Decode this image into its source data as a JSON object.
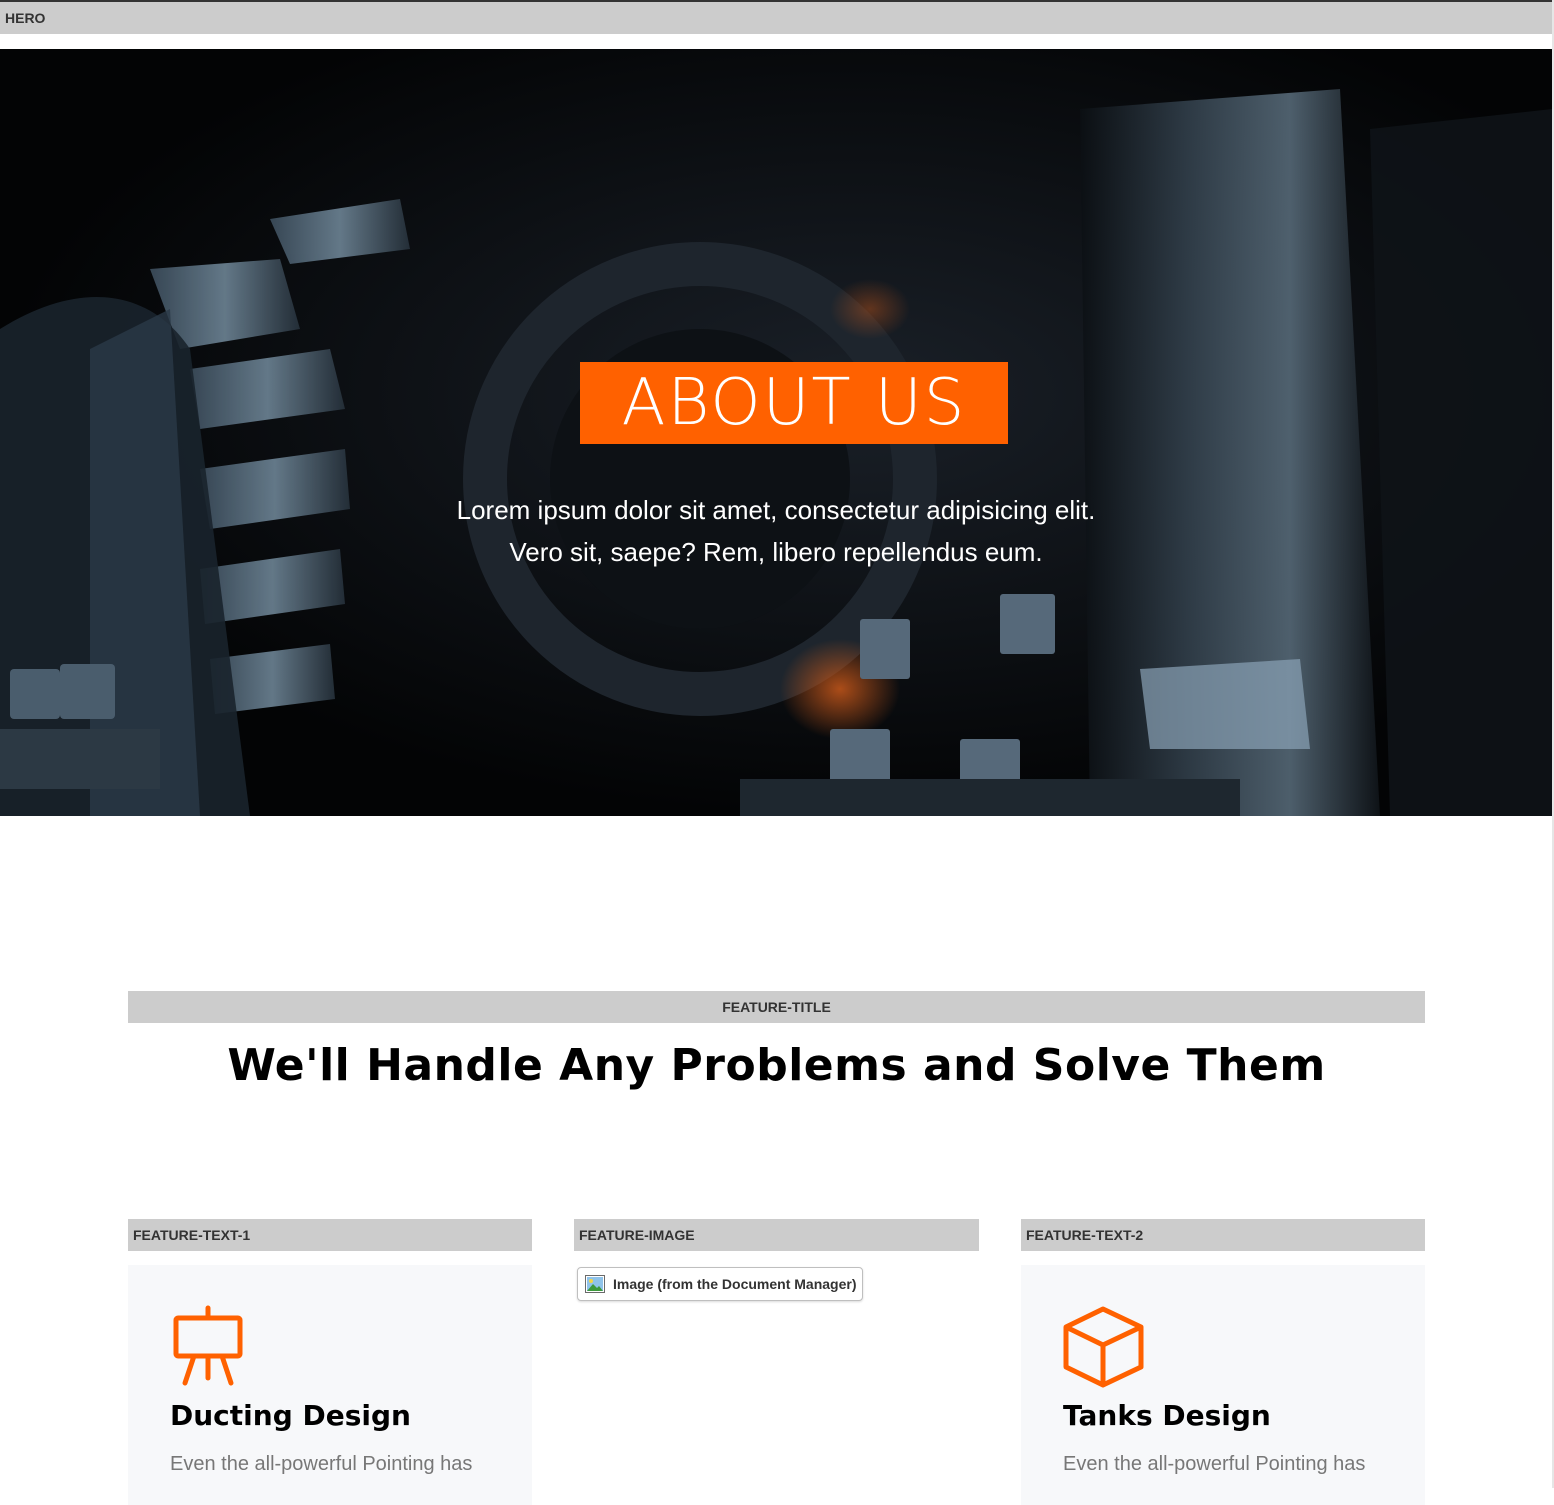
{
  "areas": {
    "hero": "HERO",
    "feature_title": "FEATURE-TITLE",
    "feature_text_1": "FEATURE-TEXT-1",
    "feature_image": "FEATURE-IMAGE",
    "feature_text_2": "FEATURE-TEXT-2"
  },
  "hero": {
    "title": "ABOUT US",
    "text": "Lorem ipsum dolor sit amet, consectetur adipisicing elit. Vero sit, saepe? Rem, libero repellendus eum."
  },
  "feature": {
    "heading": "We'll Handle Any Problems and Solve Them"
  },
  "cards": [
    {
      "icon": "easel-icon",
      "title": "Ducting Design",
      "text": "Even the all-powerful Pointing has"
    },
    {
      "icon": "cube-icon",
      "title": "Tanks Design",
      "text": "Even the all-powerful Pointing has"
    }
  ],
  "image_placeholder": {
    "icon": "image-icon",
    "label": "Image (from the Document Manager)"
  },
  "colors": {
    "accent": "#ff6100",
    "label_bar": "#cccccc",
    "card_bg": "#f7f8fa",
    "muted_text": "#777777"
  }
}
